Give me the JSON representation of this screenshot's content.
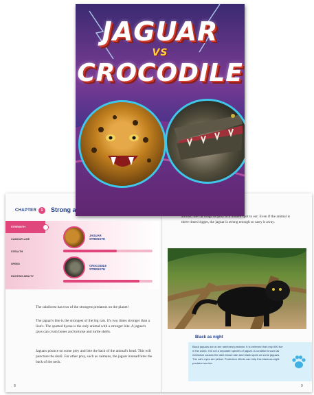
{
  "cover": {
    "title_line1": "JAGUAR",
    "title_vs": "VS",
    "title_line2": "CROCODILE",
    "colors": {
      "title": "#ffffff",
      "title_shadow": "#d23c2f",
      "ring": "#3fc6e8"
    }
  },
  "spread": {
    "chapter_label": "CHAPTER",
    "chapter_number": "1",
    "chapter_title": "Strong a",
    "abilities": [
      "STRENGTH",
      "CAMOUFLAGE",
      "STEALTH",
      "SPEED",
      "HUNTING ABILITY"
    ],
    "active_ability": "STRENGTH",
    "jaguar_label": "JAGUAR STRENGTH",
    "crocodile_label": "CROCODILE STRENGTH",
    "jaguar_strength_fraction": 0.6,
    "crocodile_strength_fraction": 0.85,
    "left_paragraphs": [
      "The rainforest has two of the strongest predators on the planet!",
      "The jaguar's bite is the strongest of the big cats. It's two times stronger than a lion's. The spotted hyena is the only animal with a stronger bite. A jaguar's jaws can crush bones and tortoise and turtle shells.",
      "Jaguars pounce on some prey and bite the back of the animal's head. This will puncture the skull. For other prey, such as caimans, the jaguar instead bites the back of the neck."
    ],
    "right_top_text": "animal, the cat drags its prey to a hidden spot to eat. Even if the animal is three times bigger, the jaguar is strong enough to carry it away.",
    "box_title": "Black as night",
    "box_text": "Black jaguars are a rare rainforest predator. It is believed that only 600 live in the world. It is not a separate species of jaguar. A condition known as melanism causes the dark brown skin and black spots on some jaguars. The cat's eyes are yellow. Protection efforts can help this black-as-night predator survive.",
    "page_left": "8",
    "page_right": "9",
    "colors": {
      "accent": "#e0467c",
      "heading": "#1f3d8a",
      "box": "#d9f0fb"
    }
  }
}
